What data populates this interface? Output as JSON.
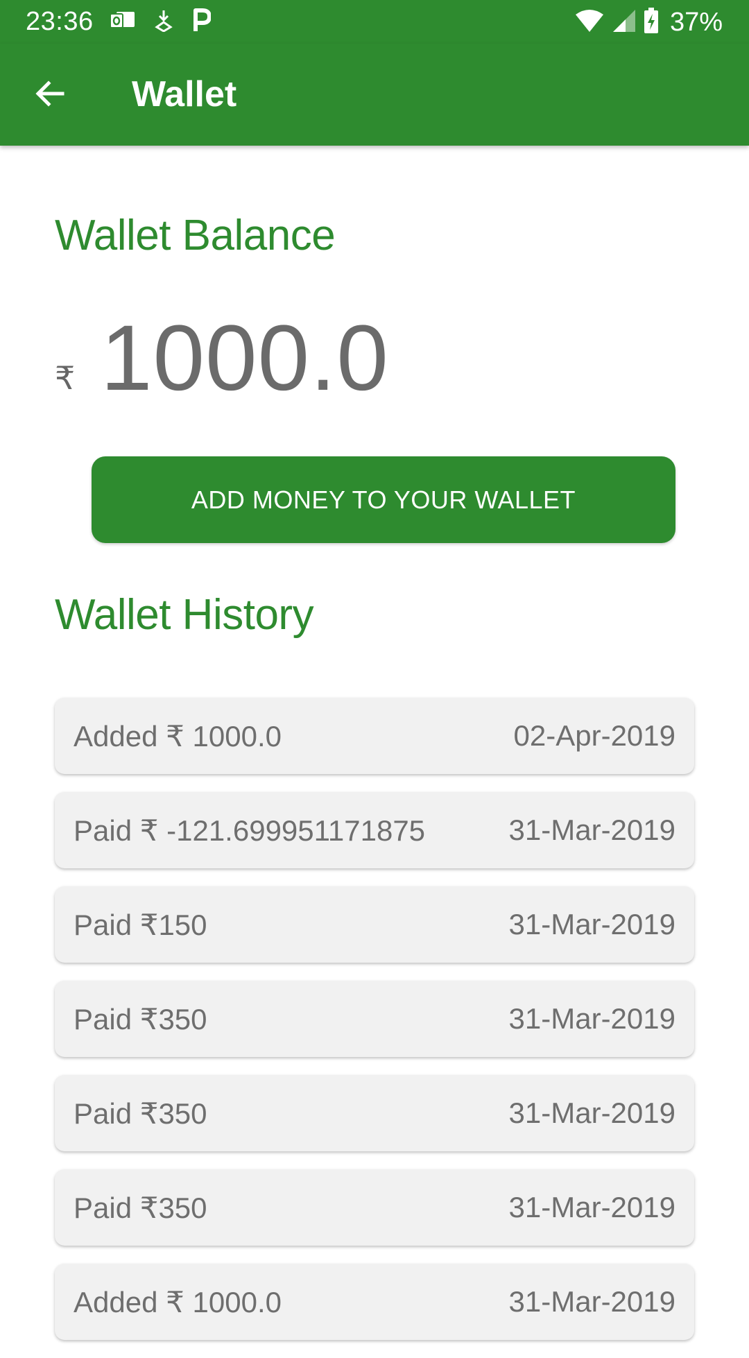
{
  "status_bar": {
    "time": "23:36",
    "left_icons": [
      "outlook-icon",
      "download-icon",
      "parking-icon"
    ],
    "right_icons": [
      "wifi-icon",
      "signal-icon",
      "battery-charging-icon"
    ],
    "battery": "37%"
  },
  "app_bar": {
    "back_icon": "arrow-left-icon",
    "title": "Wallet"
  },
  "balance": {
    "heading": "Wallet Balance",
    "currency": "₹",
    "amount": "1000.0"
  },
  "add_money_button": {
    "label": "ADD MONEY TO YOUR WALLET"
  },
  "history": {
    "heading": "Wallet History",
    "items": [
      {
        "description": "Added ₹ 1000.0",
        "date": "02-Apr-2019"
      },
      {
        "description": "Paid ₹ -121.699951171875",
        "date": "31-Mar-2019"
      },
      {
        "description": "Paid ₹150",
        "date": "31-Mar-2019"
      },
      {
        "description": "Paid ₹350",
        "date": "31-Mar-2019"
      },
      {
        "description": "Paid ₹350",
        "date": "31-Mar-2019"
      },
      {
        "description": "Paid ₹350",
        "date": "31-Mar-2019"
      },
      {
        "description": "Added ₹ 1000.0",
        "date": "31-Mar-2019"
      }
    ]
  },
  "colors": {
    "primary": "#2e8b2f",
    "balance_text": "#6b6b6b",
    "list_item_bg": "#f1f1f1"
  }
}
